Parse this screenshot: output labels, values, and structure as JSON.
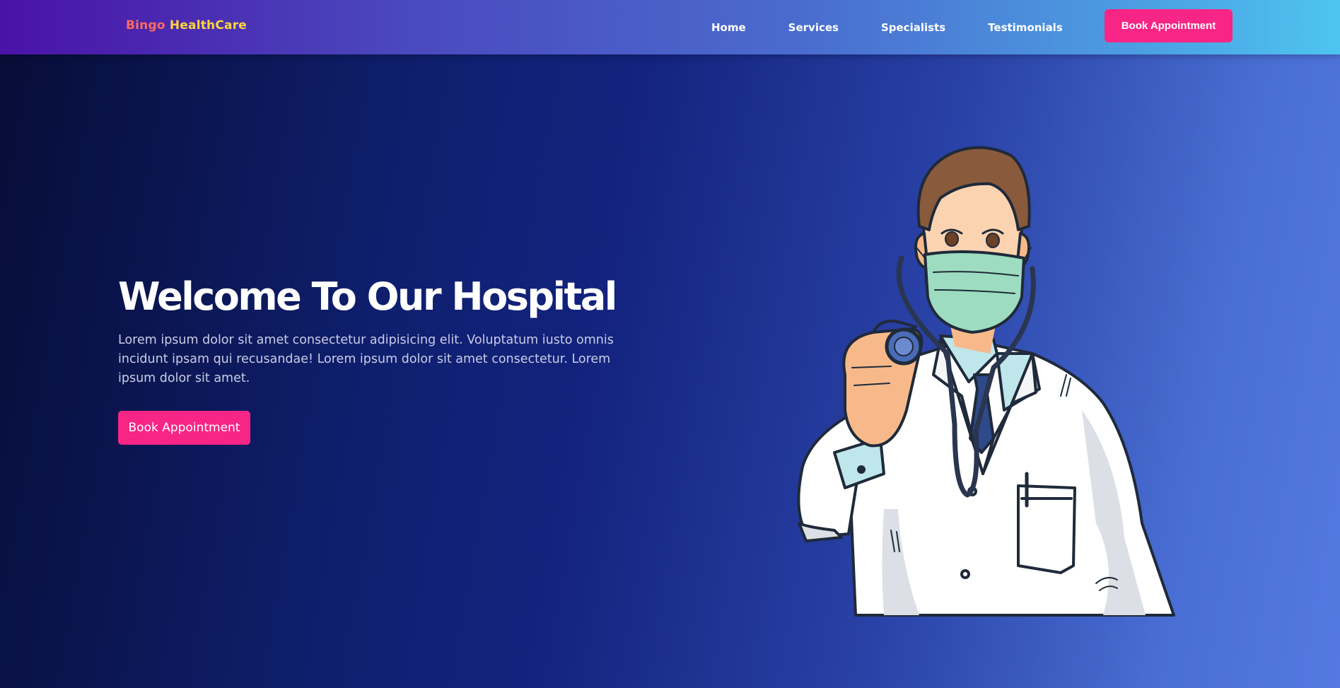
{
  "navbar": {
    "brand_part1": "Bingo",
    "brand_part2": "HealthCare",
    "links": [
      "Home",
      "Services",
      "Specialists",
      "Testimonials"
    ],
    "cta_label": "Book Appointment"
  },
  "hero": {
    "title": "Welcome To Our Hospital",
    "text": "Lorem ipsum dolor sit amet consectetur adipisicing elit. Voluptatum iusto omnis incidunt ipsam qui recusandae! Lorem ipsum dolor sit amet consectetur. Lorem ipsum dolor sit amet.",
    "cta_label": "Book Appointment",
    "illustration": "doctor-illustration"
  },
  "colors": {
    "accent": "#f72585",
    "brand_part1": "#ff6b5e",
    "brand_part2": "#ffd43b"
  }
}
